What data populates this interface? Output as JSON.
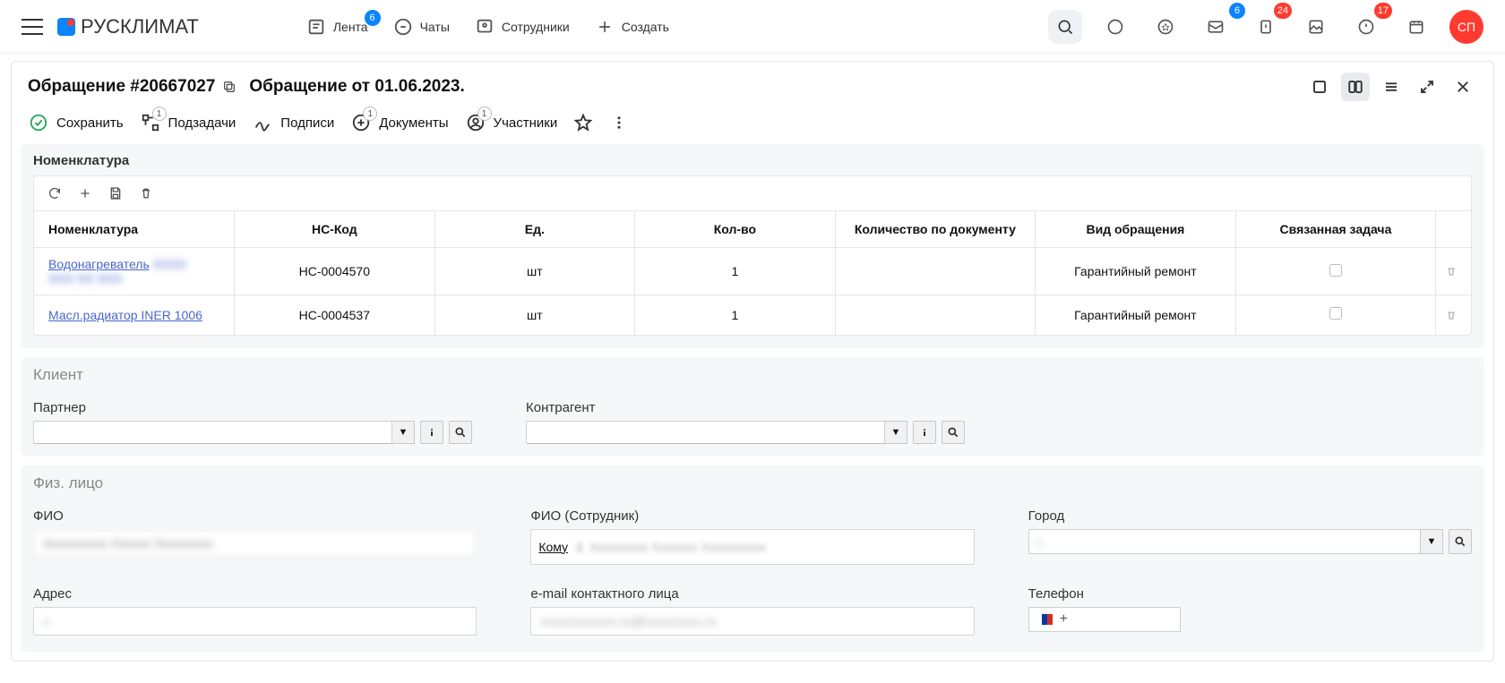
{
  "nav": {
    "logo_text": "РУСКЛИМАТ",
    "links": [
      {
        "label": "Лента",
        "badge": "6"
      },
      {
        "label": "Чаты"
      },
      {
        "label": "Сотрудники"
      },
      {
        "label": "Создать"
      }
    ],
    "right_badges": {
      "inbox": "6",
      "alerts": "24",
      "bell": "17"
    },
    "avatar": "СП"
  },
  "header": {
    "title": "Обращение #20667027",
    "subtitle": "Обращение от 01.06.2023."
  },
  "toolbar": {
    "save": "Сохранить",
    "subtasks": {
      "label": "Подзадачи",
      "count": "1"
    },
    "signatures": "Подписи",
    "documents": {
      "label": "Документы",
      "count": "1"
    },
    "participants": {
      "label": "Участники",
      "count": "1"
    }
  },
  "nomenclature": {
    "title": "Номенклатура",
    "headers": {
      "name": "Номенклатура",
      "code": "НС-Код",
      "unit": "Ед.",
      "qty": "Кол-во",
      "qty_doc": "Количество по документу",
      "type": "Вид обращения",
      "task": "Связанная задача"
    },
    "rows": [
      {
        "link": "Водонагреватель",
        "extra": "blurred",
        "code": "НС-0004570",
        "unit": "шт",
        "qty": "1",
        "type": "Гарантийный ремонт"
      },
      {
        "link": "Масл.радиатор INER 1006",
        "code": "НС-0004537",
        "unit": "шт",
        "qty": "1",
        "type": "Гарантийный ремонт"
      }
    ]
  },
  "client": {
    "title": "Клиент",
    "partner_label": "Партнер",
    "contragent_label": "Контрагент"
  },
  "person": {
    "title": "Физ. лицо",
    "fio_label": "ФИО",
    "fio_emp_label": "ФИО (Сотрудник)",
    "city_label": "Город",
    "addr_label": "Адрес",
    "email_label": "e-mail контактного лица",
    "phone_label": "Телефон",
    "to_whom": "Кому",
    "phone_plus": "+"
  }
}
